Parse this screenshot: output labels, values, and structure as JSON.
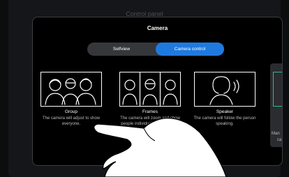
{
  "background": {
    "title": "Control panel"
  },
  "panel": {
    "title": "Camera",
    "tabs": [
      {
        "label": "Selfview",
        "active": false
      },
      {
        "label": "Camera control",
        "active": true
      }
    ],
    "modes": [
      {
        "icon": "group-icon",
        "label": "Group",
        "description": "The camera will adjust to show everyone."
      },
      {
        "icon": "frames-icon",
        "label": "Frames",
        "description": "The camera will zoom and show people individually or in smaller groups."
      },
      {
        "icon": "speaker-icon",
        "label": "Speaker",
        "description": "The camera will follow the person speaking."
      },
      {
        "icon": "manual-icon",
        "label": "Man",
        "description": "ca"
      }
    ]
  },
  "colors": {
    "accent": "#1f7ae0",
    "panel_bg": "#000000",
    "border": "#3b3d42",
    "manual_accent": "#2dbb8a"
  }
}
